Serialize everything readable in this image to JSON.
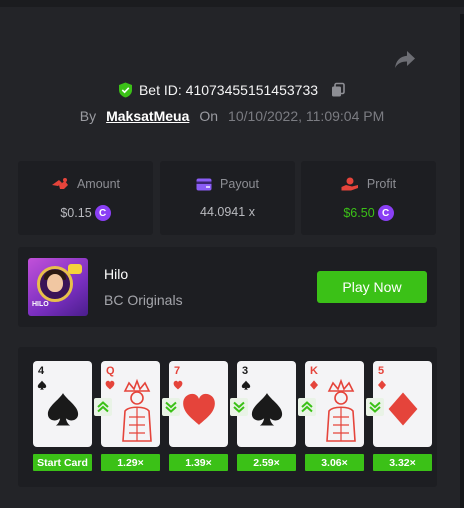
{
  "bet": {
    "id_label": "Bet ID: 41073455151453733",
    "by_label": "By",
    "username": "MaksatMeua",
    "on_label": "On",
    "datetime": "10/10/2022, 11:09:04 PM"
  },
  "stats": {
    "amount": {
      "label": "Amount",
      "value": "$0.15"
    },
    "payout": {
      "label": "Payout",
      "value": "44.0941 x"
    },
    "profit": {
      "label": "Profit",
      "value": "$6.50"
    },
    "coin_glyph": "C"
  },
  "game": {
    "name": "Hilo",
    "provider": "BC Originals",
    "thumb_tag": "HILO",
    "play_label": "Play Now"
  },
  "cards": [
    {
      "rank": "4",
      "suit": "spade",
      "color": "#1a1a1a",
      "direction": "start",
      "multiplier": "Start Card"
    },
    {
      "rank": "Q",
      "suit": "heart",
      "color": "#e5443b",
      "direction": "higher",
      "multiplier": "1.29×"
    },
    {
      "rank": "7",
      "suit": "heart",
      "color": "#e5443b",
      "direction": "lower",
      "multiplier": "1.39×"
    },
    {
      "rank": "3",
      "suit": "spade",
      "color": "#1a1a1a",
      "direction": "lower",
      "multiplier": "2.59×"
    },
    {
      "rank": "K",
      "suit": "diamond",
      "color": "#e5443b",
      "direction": "higher",
      "multiplier": "3.06×"
    },
    {
      "rank": "5",
      "suit": "diamond",
      "color": "#e5443b",
      "direction": "lower",
      "multiplier": "3.32×"
    }
  ],
  "colors": {
    "background": "#232428",
    "panel": "#1d1e22",
    "accent_green": "#3bc117",
    "coin_purple": "#8a3ff5",
    "red_suit": "#e5443b"
  }
}
